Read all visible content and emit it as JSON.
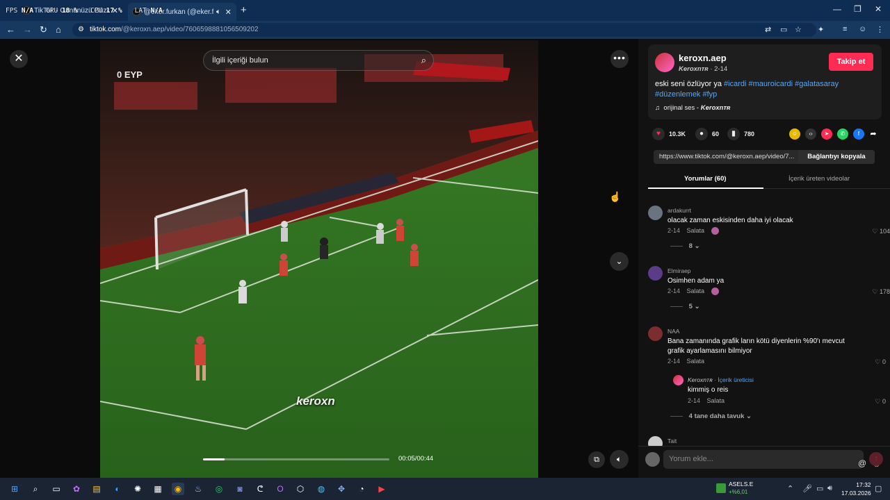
{
  "browser": {
    "tabs": [
      {
        "title": "TikTok - Gününüzü Güzelleştirin"
      },
      {
        "title": "@eker.furkan (@eker.furkan)"
      }
    ],
    "url_host": "tiktok.com",
    "url_path": "/@keroxn.aep/video/7606598881056509202"
  },
  "osd": {
    "fps_label": "FPS",
    "fps_value": "N/A",
    "gpu_label": "GPU",
    "gpu_value": "18 %",
    "cpu_label": "CPU",
    "cpu_value": "17 %",
    "lat_label": "LAT",
    "lat_value": "N/A"
  },
  "player": {
    "search_placeholder": "İlgili içeriği bulun",
    "time": "00:05/00:44",
    "progress": 0.114,
    "watermark": "keroxn",
    "scorebug": "0  EYP"
  },
  "post": {
    "username": "keroxn.aep",
    "display_name": "Keroxnᴛʀ",
    "date": "2-14",
    "follow_label": "Takip et",
    "desc_text": "eski seni özlüyor ya ",
    "hashtags": [
      "#icardi",
      "#mauroicardi",
      "#galatasaray",
      "#düzenlemek",
      "#fyp"
    ],
    "music_text": "orijinal ses - ",
    "music_author": "Keroxnᴛʀ",
    "likes": "10.3K",
    "comments": "60",
    "saves": "780",
    "link": "https://www.tiktok.com/@keroxn.aep/video/7...",
    "copy_label": "Bağlantıyı kopyala"
  },
  "tabs": {
    "comments": "Yorumlar (60)",
    "creator_videos": "İçerik üreten videolar"
  },
  "comments": [
    {
      "user": "ardakurrt",
      "text": "olacak zaman eskisinden daha iyi olacak",
      "date": "2-14",
      "reply": "Salata",
      "likes": "104",
      "replies": "8"
    },
    {
      "user": "Elmiraep",
      "text": "Osimhen adam ya",
      "date": "2-14",
      "reply": "Salata",
      "likes": "178",
      "replies": "5"
    },
    {
      "user": "NAA",
      "text": "Bana zamanında grafik ların kötü diyenlerin %90'ı mevcut grafik ayarlamasını bilmiyor",
      "date": "2-14",
      "reply": "Salata",
      "likes": "0"
    },
    {
      "user": "Keroxnᴛʀ",
      "creator_badge": "İçerik üreticisi",
      "text": "kimmiş o reis",
      "date": "2-14",
      "reply": "Salata",
      "likes": "0"
    },
    {
      "more": "4 tane daha tavuk"
    },
    {
      "user": "Tait"
    }
  ],
  "composer": {
    "placeholder": "Yorum ekle..."
  },
  "taskbar": {
    "stock_name": "ASELS.E",
    "stock_change": "+%6,01",
    "time": "17:32",
    "date": "17.03.2026"
  },
  "colors": {
    "accent": "#fe2c55",
    "hashtag": "#5aa7f5",
    "browser": "#0f2d52"
  }
}
